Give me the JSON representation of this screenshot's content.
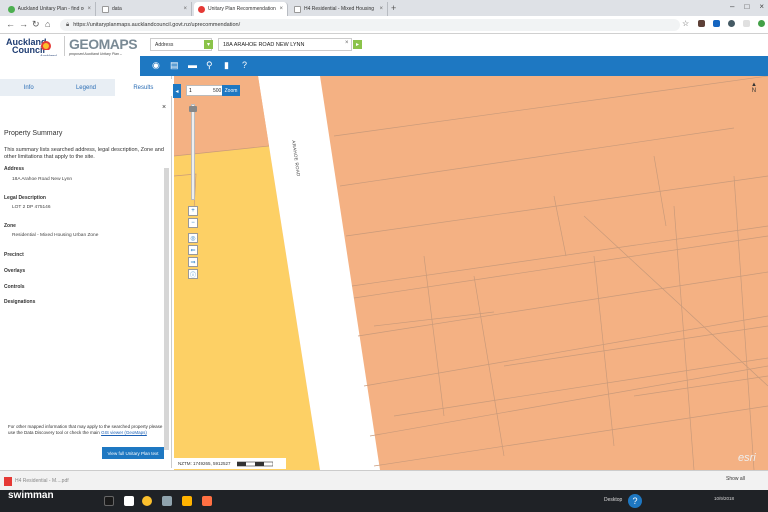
{
  "browser": {
    "tabs": [
      {
        "label": "Auckland Unitary Plan - find our",
        "color": "#4caf50"
      },
      {
        "label": "data",
        "color": "#9e9e9e"
      },
      {
        "label": "Unitary Plan Recommendation",
        "color": "#e53935"
      },
      {
        "label": "H4 Residential - Mixed Housing",
        "color": "#9e9e9e"
      }
    ],
    "url": "https://unitaryplanmaps.aucklandcouncil.govt.nz/uprecommendation/"
  },
  "header": {
    "logo_line1": "Auckland",
    "logo_line2": "Council",
    "logo_tag": "Auckland",
    "geomaps": "GEOMAPS",
    "geomaps_sub1": "proposed Auckland Unitary Plan –",
    "geomaps_sub2": "Recommendation version",
    "geomaps_sub3": "(22 July 2016)",
    "search_type": "Address",
    "search_value": "18A ARAHOE ROAD NEW LYNN"
  },
  "panel": {
    "tabs": [
      "Info",
      "Legend",
      "Results"
    ],
    "title": "Property Summary",
    "intro": "This summary lists searched address, legal description, Zone and other limitations that apply to the site.",
    "address_label": "Address",
    "address_value": "18A Arahoe Road New Lynn",
    "legal_label": "Legal Description",
    "legal_value": "LOT 2 DP 475146",
    "zone_label": "Zone",
    "zone_value": "Residential - Mixed Housing Urban Zone",
    "precinct_label": "Precinct",
    "overlays_label": "Overlays",
    "controls_label": "Controls",
    "designations_label": "Designations",
    "footer_text": "For other mapped information that may apply to the searched property please use the Data Discovery tool or check the main",
    "footer_link": "GIS viewer (GeoMaps)",
    "view_button": "View full Unitary Plan text"
  },
  "map": {
    "scale_value": "1",
    "scale_suffix": "500",
    "zoom_label": "Zoom",
    "road_label": "ARAHOE ROAD",
    "north_label": "N",
    "coords": "NZTM: 1749265, 5912527",
    "esri": "esri",
    "colors": {
      "zone_orange": "#f4b183",
      "zone_yellow": "#fdd065",
      "road": "#ffffff",
      "parcel_line": "#c99a7a"
    }
  },
  "downloads": {
    "item": "H4 Residential - M....pdf",
    "show_all": "Show all"
  },
  "taskbar": {
    "watermark": "swimman",
    "desktop": "Desktop",
    "time": "",
    "date": "10/9/2018"
  }
}
